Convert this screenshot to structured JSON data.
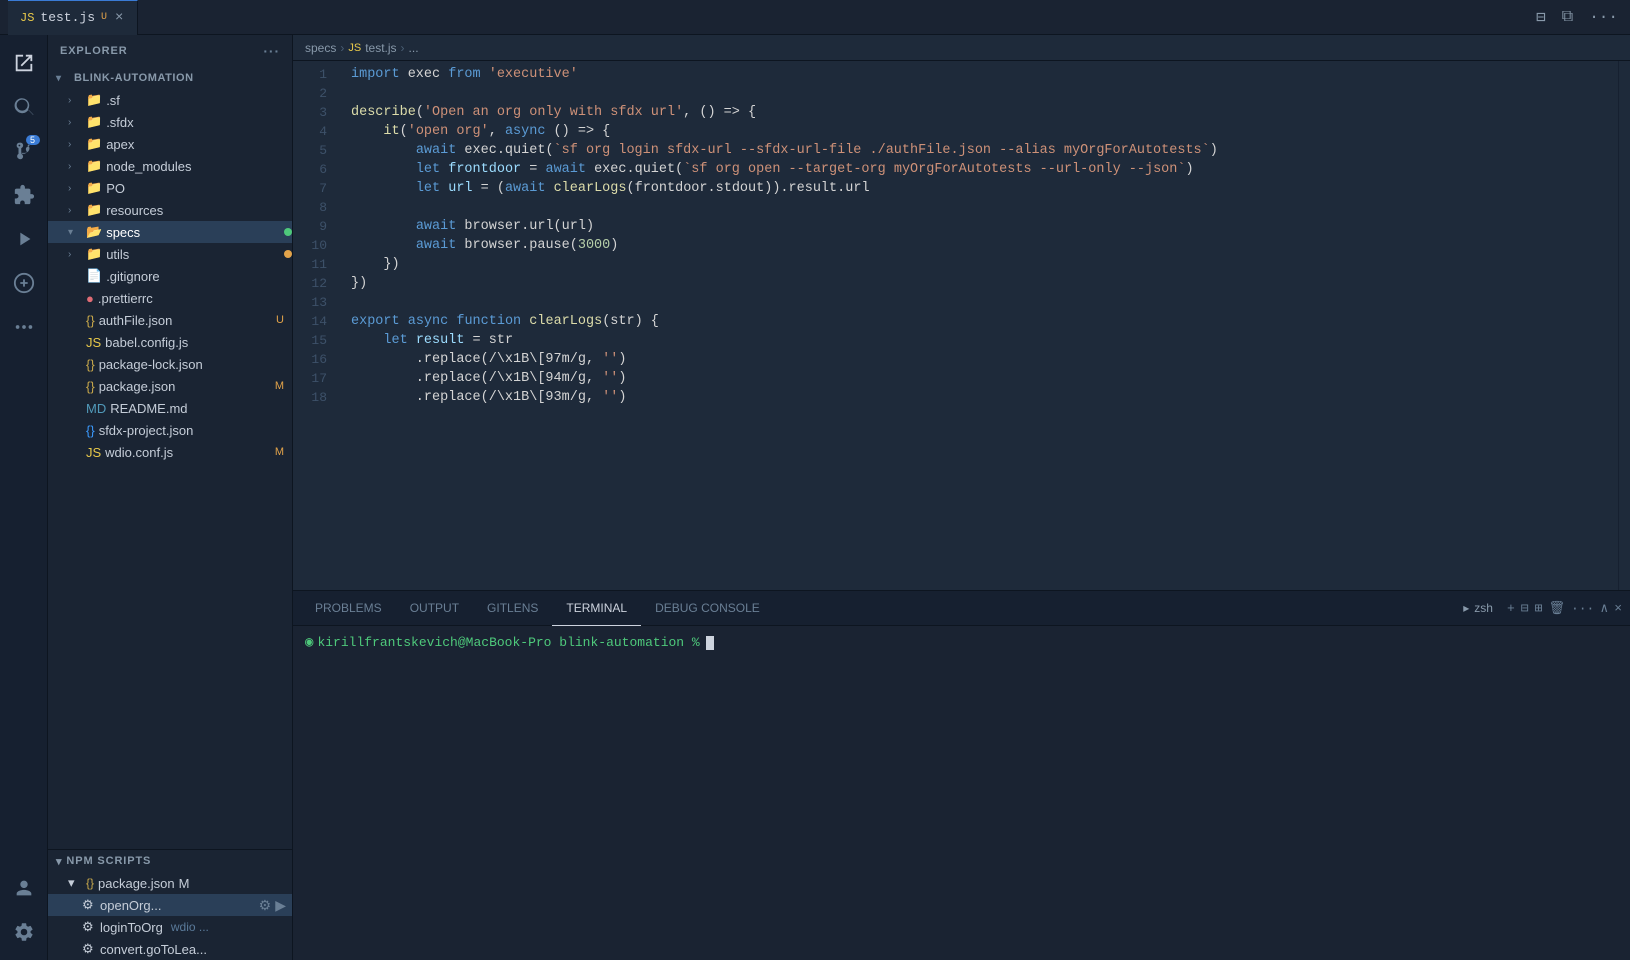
{
  "titlebar": {
    "tab_name": "test.js",
    "tab_modified": "U",
    "tab_close": "×"
  },
  "breadcrumb": {
    "folder": "specs",
    "separator1": ">",
    "file_icon": "JS",
    "file": "test.js",
    "separator2": ">",
    "dots": "..."
  },
  "sidebar": {
    "header": "EXPLORER",
    "header_more": "···",
    "root": "BLINK-AUTOMATION",
    "items": [
      {
        "name": ".sf",
        "type": "folder",
        "indent": 1
      },
      {
        "name": ".sfdx",
        "type": "folder",
        "indent": 1
      },
      {
        "name": "apex",
        "type": "folder",
        "indent": 1
      },
      {
        "name": "node_modules",
        "type": "folder",
        "indent": 1
      },
      {
        "name": "PO",
        "type": "folder",
        "indent": 1
      },
      {
        "name": "resources",
        "type": "folder",
        "indent": 1
      },
      {
        "name": "specs",
        "type": "folder",
        "indent": 1,
        "badge": "green",
        "active": true
      },
      {
        "name": "utils",
        "type": "folder",
        "indent": 1,
        "badge": "orange"
      },
      {
        "name": ".gitignore",
        "type": "file",
        "indent": 1
      },
      {
        "name": ".prettierrc",
        "type": "file-dot",
        "indent": 1
      },
      {
        "name": "authFile.json",
        "type": "json",
        "indent": 1,
        "modified": "U"
      },
      {
        "name": "babel.config.js",
        "type": "js",
        "indent": 1
      },
      {
        "name": "package-lock.json",
        "type": "json",
        "indent": 1
      },
      {
        "name": "package.json",
        "type": "json",
        "indent": 1,
        "modified": "M"
      },
      {
        "name": "README.md",
        "type": "md",
        "indent": 1
      },
      {
        "name": "sfdx-project.json",
        "type": "json",
        "indent": 1
      },
      {
        "name": "wdio.conf.js",
        "type": "js",
        "indent": 1,
        "modified": "M"
      }
    ]
  },
  "npm_scripts": {
    "header": "NPM SCRIPTS",
    "package_file": "package.json",
    "package_modified": "M",
    "scripts": [
      {
        "name": "openOrg...",
        "active": true
      },
      {
        "name": "loginToOrg",
        "suffix": "wdio ..."
      },
      {
        "name": "convert.goToLea..."
      }
    ]
  },
  "code": {
    "lines": [
      {
        "num": 1,
        "content": "import_exec_from_executive"
      },
      {
        "num": 2,
        "content": ""
      },
      {
        "num": 3,
        "content": "describe_open_an_org"
      },
      {
        "num": 4,
        "content": "it_open_org"
      },
      {
        "num": 5,
        "content": "await_exec_quiet_sf_org_login"
      },
      {
        "num": 6,
        "content": "let_frontdoor_await"
      },
      {
        "num": 7,
        "content": "let_url_await"
      },
      {
        "num": 8,
        "content": ""
      },
      {
        "num": 9,
        "content": "await_browser_url"
      },
      {
        "num": 10,
        "content": "await_browser_pause"
      },
      {
        "num": 11,
        "content": "close_it"
      },
      {
        "num": 12,
        "content": "close_describe"
      },
      {
        "num": 13,
        "content": ""
      },
      {
        "num": 14,
        "content": "export_async_function"
      },
      {
        "num": 15,
        "content": "let_result_str"
      },
      {
        "num": 16,
        "content": "replace_97m"
      },
      {
        "num": 17,
        "content": "replace_94m"
      },
      {
        "num": 18,
        "content": "replace_93m"
      }
    ]
  },
  "panel": {
    "tabs": [
      {
        "name": "PROBLEMS"
      },
      {
        "name": "OUTPUT"
      },
      {
        "name": "GITLENS"
      },
      {
        "name": "TERMINAL",
        "active": true
      },
      {
        "name": "DEBUG CONSOLE"
      }
    ],
    "terminal_shell": "zsh",
    "terminal_prompt": "kirillfrantskevich@MacBook-Pro blink-automation % "
  },
  "activity": {
    "explorer_tooltip": "Explorer",
    "search_tooltip": "Search",
    "source_control_tooltip": "Source Control",
    "source_control_badge": "5",
    "extensions_tooltip": "Extensions",
    "account_tooltip": "Account",
    "settings_tooltip": "Settings"
  }
}
